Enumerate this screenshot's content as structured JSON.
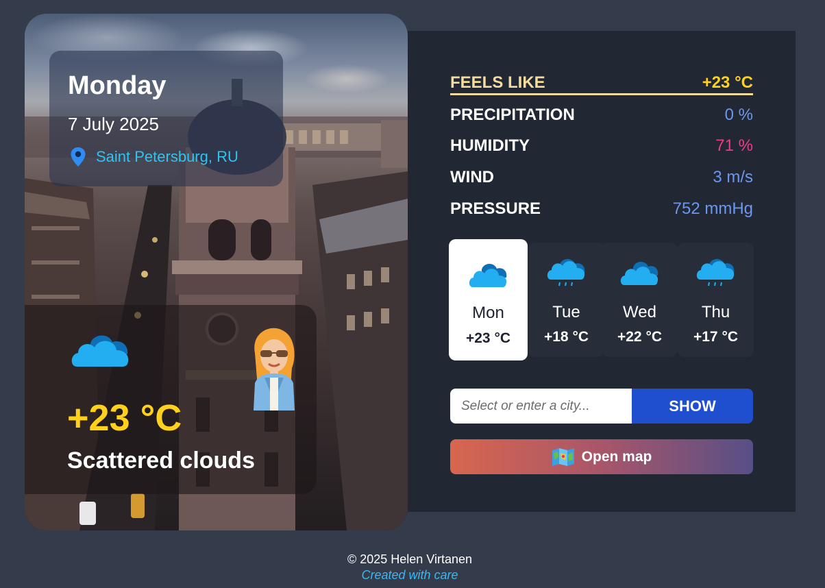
{
  "summary": {
    "day": "Monday",
    "date": "7 July 2025",
    "location": "Saint Petersburg, RU",
    "temperature": "+23 °C",
    "condition": "Scattered clouds",
    "icon": "cloud-icon"
  },
  "details": [
    {
      "key": "feels_like",
      "label": "FEELS LIKE",
      "value": "+23 °C",
      "color": "#ffd11a"
    },
    {
      "key": "precipitation",
      "label": "PRECIPITATION",
      "value": "0 %",
      "color": "#6b97f0"
    },
    {
      "key": "humidity",
      "label": "HUMIDITY",
      "value": "71 %",
      "color": "#ec3d8c"
    },
    {
      "key": "wind",
      "label": "WIND",
      "value": "3 m/s",
      "color": "#6b97f0"
    },
    {
      "key": "pressure",
      "label": "PRESSURE",
      "value": "752 mmHg",
      "color": "#6b97f0"
    }
  ],
  "forecast": [
    {
      "day": "Mon",
      "temp": "+23 °C",
      "icon": "cloud-icon",
      "active": true
    },
    {
      "day": "Tue",
      "temp": "+18 °C",
      "icon": "rain-cloud-icon",
      "active": false
    },
    {
      "day": "Wed",
      "temp": "+22 °C",
      "icon": "cloud-icon",
      "active": false
    },
    {
      "day": "Thu",
      "temp": "+17 °C",
      "icon": "rain-cloud-icon",
      "active": false
    }
  ],
  "search": {
    "placeholder": "Select or enter a city...",
    "value": "",
    "button_label": "SHOW"
  },
  "map_button": {
    "label": "Open map",
    "icon": "map-icon"
  },
  "footer": {
    "copyright": "© 2025 Helen Virtanen",
    "credits": "Created with care"
  },
  "colors": {
    "page_bg": "#343c4b",
    "panel_bg": "#222833",
    "accent_yellow": "#ffd11a",
    "accent_blue": "#1f4fcf",
    "location_cyan": "#2ec4f1"
  }
}
